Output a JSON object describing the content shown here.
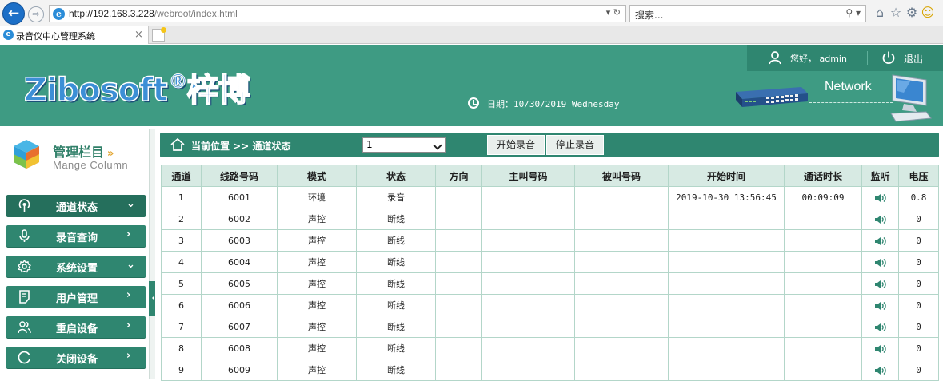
{
  "browser": {
    "url_main": "http://192.168.3.228",
    "url_path": "/webroot/index.html",
    "url_controls": "▾ ↻",
    "search_placeholder": "搜索...",
    "search_controls": "⚲ ▾",
    "tab_title": "录音仪中心管理系统",
    "tab_close": "×"
  },
  "header": {
    "logo_text": "Zibosoft",
    "logo_mark": "®",
    "logo_cn": "梓博",
    "greeting": "您好， admin",
    "logout": "退出",
    "date_label": "日期：10/30/2019 Wednesday",
    "network_label": "Network"
  },
  "sidebar": {
    "title": "管理栏目",
    "title_arrows": "»",
    "subtitle": "Mange Column",
    "items": [
      {
        "label": "通道状态",
        "chevron": "⌄"
      },
      {
        "label": "录音查询",
        "chevron": "›"
      },
      {
        "label": "系统设置",
        "chevron": "⌄"
      },
      {
        "label": "用户管理",
        "chevron": "›"
      },
      {
        "label": "重启设备",
        "chevron": "›"
      },
      {
        "label": "关闭设备",
        "chevron": "›"
      }
    ]
  },
  "main": {
    "breadcrumb": "当前位置 >> 通道状态",
    "channel_selected": "1",
    "start_button": "开始录音",
    "stop_button": "停止录音",
    "columns": [
      "通道",
      "线路号码",
      "模式",
      "状态",
      "方向",
      "主叫号码",
      "被叫号码",
      "开始时间",
      "通话时长",
      "监听",
      "电压"
    ],
    "rows": [
      {
        "ch": "1",
        "line": "6001",
        "mode": "环境",
        "status": "录音",
        "dir": "",
        "caller": "",
        "callee": "",
        "start": "2019-10-30 13:56:45",
        "dur": "00:09:09",
        "volt": "0.8"
      },
      {
        "ch": "2",
        "line": "6002",
        "mode": "声控",
        "status": "断线",
        "dir": "",
        "caller": "",
        "callee": "",
        "start": "",
        "dur": "",
        "volt": "0"
      },
      {
        "ch": "3",
        "line": "6003",
        "mode": "声控",
        "status": "断线",
        "dir": "",
        "caller": "",
        "callee": "",
        "start": "",
        "dur": "",
        "volt": "0"
      },
      {
        "ch": "4",
        "line": "6004",
        "mode": "声控",
        "status": "断线",
        "dir": "",
        "caller": "",
        "callee": "",
        "start": "",
        "dur": "",
        "volt": "0"
      },
      {
        "ch": "5",
        "line": "6005",
        "mode": "声控",
        "status": "断线",
        "dir": "",
        "caller": "",
        "callee": "",
        "start": "",
        "dur": "",
        "volt": "0"
      },
      {
        "ch": "6",
        "line": "6006",
        "mode": "声控",
        "status": "断线",
        "dir": "",
        "caller": "",
        "callee": "",
        "start": "",
        "dur": "",
        "volt": "0"
      },
      {
        "ch": "7",
        "line": "6007",
        "mode": "声控",
        "status": "断线",
        "dir": "",
        "caller": "",
        "callee": "",
        "start": "",
        "dur": "",
        "volt": "0"
      },
      {
        "ch": "8",
        "line": "6008",
        "mode": "声控",
        "status": "断线",
        "dir": "",
        "caller": "",
        "callee": "",
        "start": "",
        "dur": "",
        "volt": "0"
      },
      {
        "ch": "9",
        "line": "6009",
        "mode": "声控",
        "status": "断线",
        "dir": "",
        "caller": "",
        "callee": "",
        "start": "",
        "dur": "",
        "volt": "0"
      }
    ]
  },
  "colors": {
    "primary_green": "#2f8670",
    "header_green": "#3e9b83",
    "table_header_bg": "#d7eae3",
    "speaker_green": "#2f8670"
  }
}
